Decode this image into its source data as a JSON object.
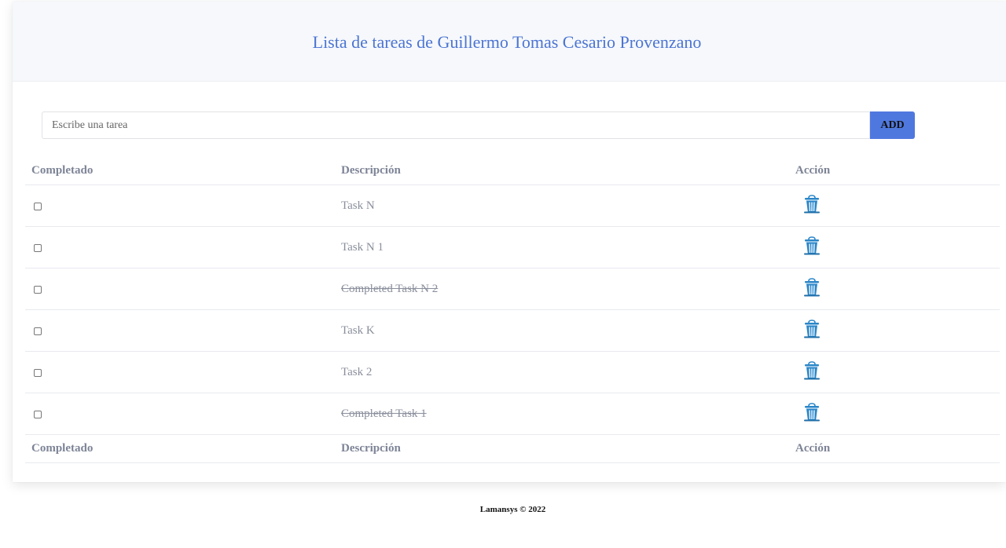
{
  "header": {
    "title": "Lista de tareas de Guillermo Tomas Cesario Provenzano"
  },
  "form": {
    "placeholder": "Escribe una tarea",
    "add_label": "ADD"
  },
  "table": {
    "headers": {
      "completed": "Completado",
      "description": "Descripción",
      "action": "Acción"
    },
    "rows": [
      {
        "description": "Task N",
        "completed": false
      },
      {
        "description": "Task N 1",
        "completed": false
      },
      {
        "description": "Completed Task N 2",
        "completed": true
      },
      {
        "description": "Task K",
        "completed": false
      },
      {
        "description": "Task 2",
        "completed": false
      },
      {
        "description": "Completed Task 1",
        "completed": true
      }
    ],
    "action_icon": "trash-icon"
  },
  "footer": {
    "text": "Lamansys © 2022"
  },
  "colors": {
    "accent": "#4f78df",
    "title": "#4b74d3",
    "trash": "#2a86c8"
  }
}
